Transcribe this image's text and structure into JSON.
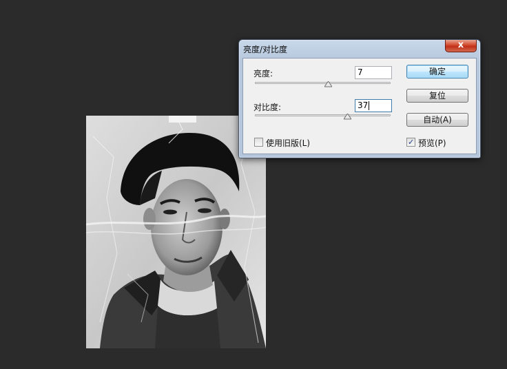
{
  "canvas": {
    "photo_description_icon": "grayscale-portrait-photo"
  },
  "dialog": {
    "title": "亮度/对比度",
    "close_glyph": "x",
    "brightness": {
      "label": "亮度:",
      "value": "7",
      "slider_fraction": 0.54
    },
    "contrast": {
      "label": "对比度:",
      "value": "37",
      "slider_fraction": 0.68
    },
    "buttons": {
      "ok": "确定",
      "reset": "复位",
      "auto": "自动(A)"
    },
    "legacy": {
      "label": "使用旧版(L)",
      "checked": false
    },
    "preview": {
      "label": "预览(P)",
      "checked": true,
      "check_glyph": "✓"
    }
  },
  "colors": {
    "workspace_bg": "#2b2b2b",
    "close_button_red": "#c1301a",
    "default_button_blue": "#a7d9f5"
  }
}
